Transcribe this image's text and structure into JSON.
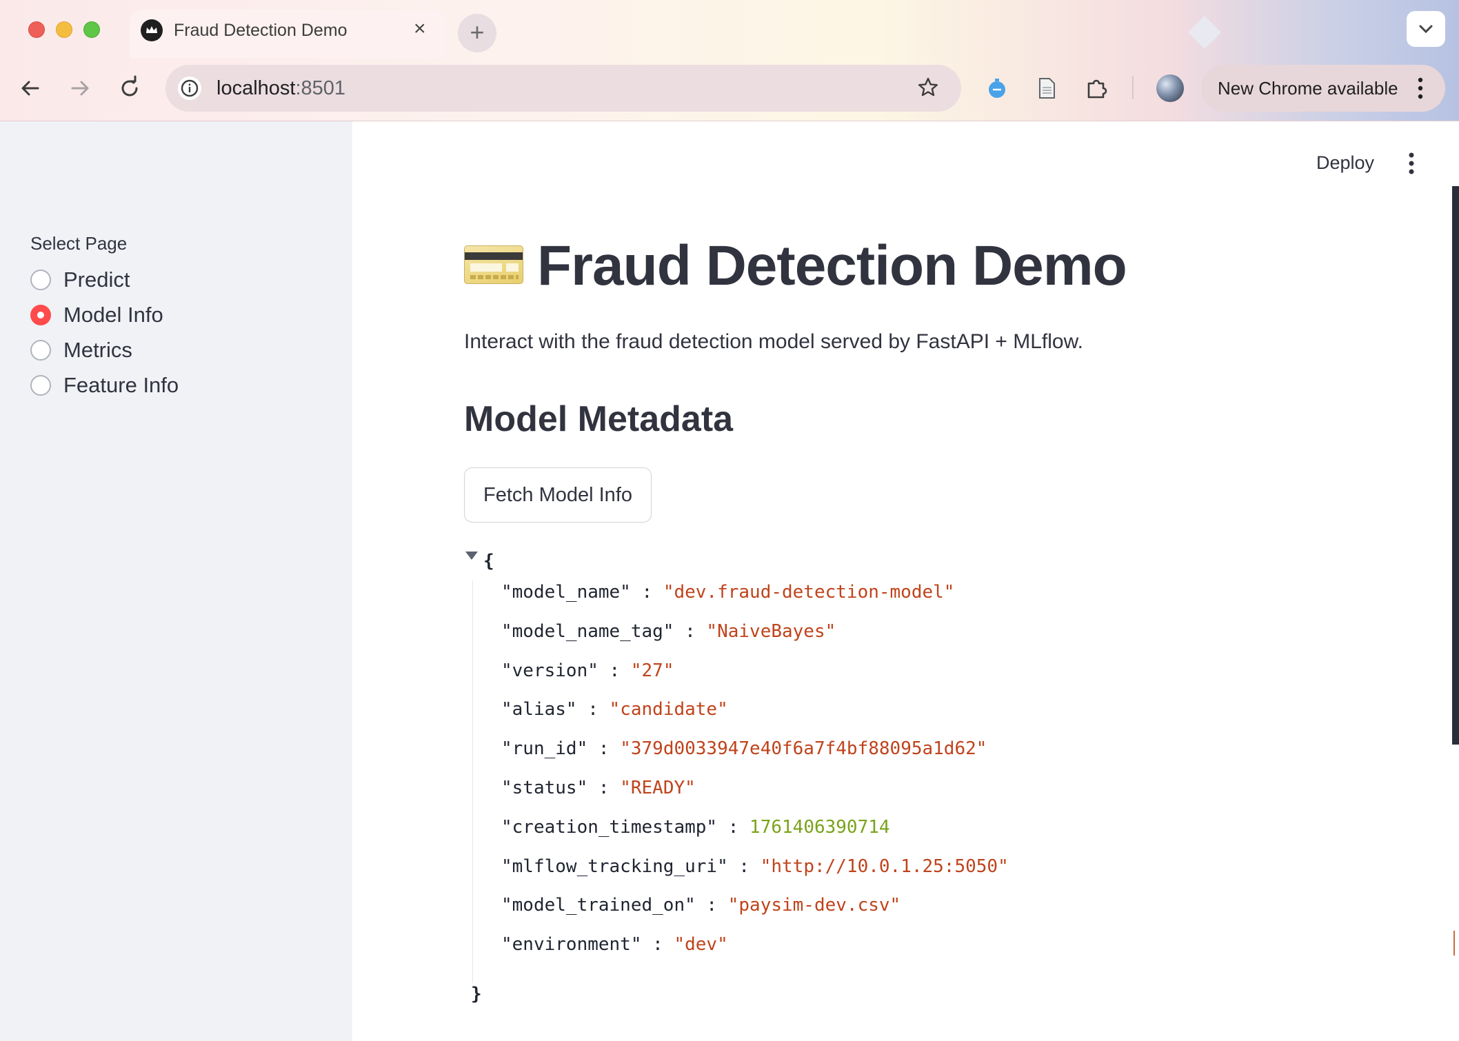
{
  "browser": {
    "tab_title": "Fraud Detection Demo",
    "new_tab_symbol": "+",
    "close_symbol": "×",
    "url_host": "localhost",
    "url_port": ":8501",
    "update_label": "New Chrome available"
  },
  "sidebar": {
    "label": "Select Page",
    "options": [
      "Predict",
      "Model Info",
      "Metrics",
      "Feature Info"
    ],
    "selected": "Model Info"
  },
  "header": {
    "deploy_label": "Deploy"
  },
  "main": {
    "title": "Fraud Detection Demo",
    "subtitle": "Interact with the fraud detection model served by FastAPI + MLflow.",
    "section_title": "Model Metadata",
    "fetch_button_label": "Fetch Model Info",
    "json_open": "{",
    "json_close": "}",
    "json_entries": [
      {
        "key": "\"model_name\"",
        "value": "\"dev.fraud-detection-model\"",
        "type": "string"
      },
      {
        "key": "\"model_name_tag\"",
        "value": "\"NaiveBayes\"",
        "type": "string"
      },
      {
        "key": "\"version\"",
        "value": "\"27\"",
        "type": "string"
      },
      {
        "key": "\"alias\"",
        "value": "\"candidate\"",
        "type": "string"
      },
      {
        "key": "\"run_id\"",
        "value": "\"379d0033947e40f6a7f4bf88095a1d62\"",
        "type": "string"
      },
      {
        "key": "\"status\"",
        "value": "\"READY\"",
        "type": "string"
      },
      {
        "key": "\"creation_timestamp\"",
        "value": "1761406390714",
        "type": "number"
      },
      {
        "key": "\"mlflow_tracking_uri\"",
        "value": "\"http://10.0.1.25:5050\"",
        "type": "string"
      },
      {
        "key": "\"model_trained_on\"",
        "value": "\"paysim-dev.csv\"",
        "type": "string"
      },
      {
        "key": "\"environment\"",
        "value": "\"dev\"",
        "type": "string"
      }
    ]
  },
  "colors": {
    "accent": "#ff4b4b",
    "sidebar_bg": "#f0f2f6",
    "json_string": "#c0431b",
    "json_number": "#7aa31a"
  },
  "icons": {
    "tab_favicon": "streamlit-crown-icon",
    "page_icon": "credit-card-icon"
  }
}
